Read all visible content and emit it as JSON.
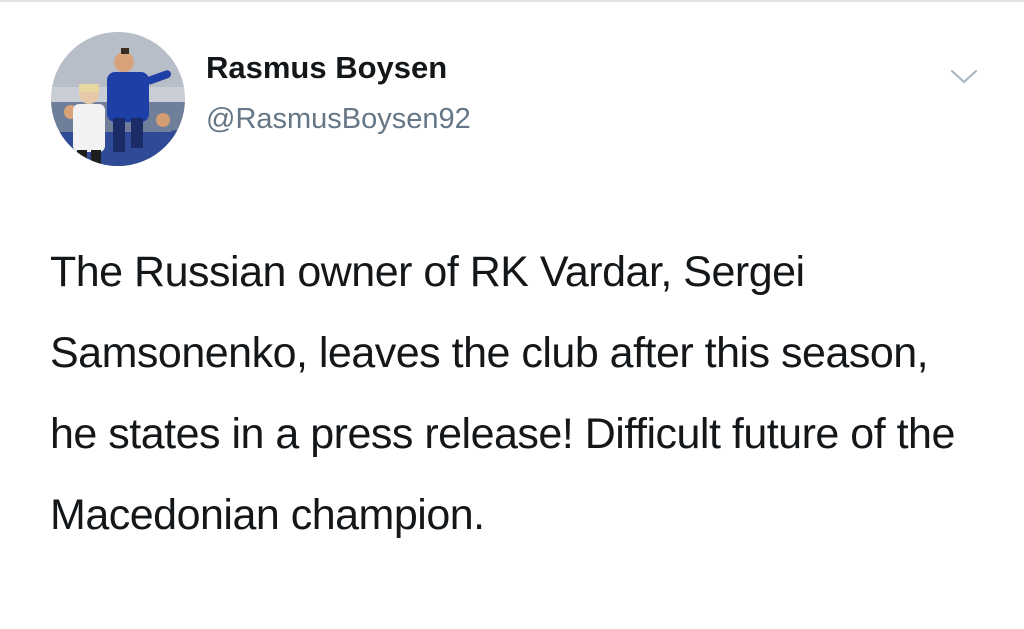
{
  "tweet": {
    "author": {
      "display_name": "Rasmus Boysen",
      "handle": "@RasmusBoysen92",
      "avatar": "handball-player-photo"
    },
    "menu_icon": "chevron-down-icon",
    "text": "The Russian owner of RK Vardar, Sergei Samsonenko, leaves the club after this season, he states in a press release! Difficult future of the Macedonian champion."
  },
  "colors": {
    "background": "#ffffff",
    "text_primary": "#14171a",
    "text_secondary": "#657786",
    "chevron": "#aab8c2"
  }
}
